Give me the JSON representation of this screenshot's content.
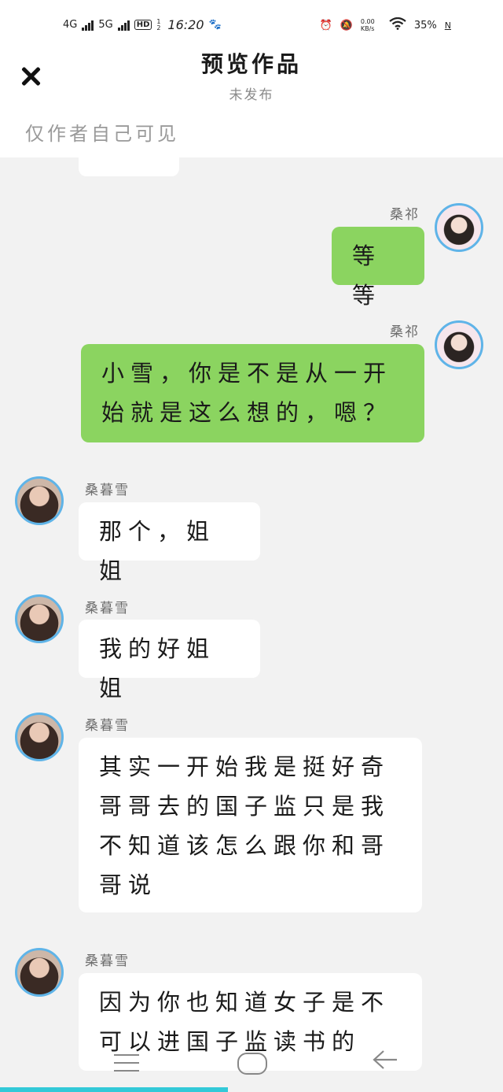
{
  "status_bar": {
    "net1": "4G",
    "net2": "5G",
    "hd": "HD",
    "hd_sub": "1 2",
    "time": "16:20",
    "speed": "0.00 KB/s",
    "battery": "35%",
    "nfc": "N"
  },
  "header": {
    "title": "预览作品",
    "subtitle": "未发布",
    "visibility_note": "仅作者自己可见"
  },
  "messages": [
    {
      "sender": "桑祁",
      "side": "right",
      "text": "等等"
    },
    {
      "sender": "桑祁",
      "side": "right",
      "text": "小雪，你是不是从一开始就是这么想的，嗯？"
    },
    {
      "sender": "桑暮雪",
      "side": "left",
      "text": "那个，姐姐"
    },
    {
      "sender": "桑暮雪",
      "side": "left",
      "text": "我的好姐姐"
    },
    {
      "sender": "桑暮雪",
      "side": "left",
      "text": "其实一开始我是挺好奇哥哥去的国子监只是我不知道该怎么跟你和哥哥说"
    },
    {
      "sender": "桑暮雪",
      "side": "left",
      "text": "因为你也知道女子是不可以进国子监读书的"
    }
  ],
  "colors": {
    "outgoing_bubble": "#8bd460",
    "incoming_bubble": "#ffffff",
    "avatar_ring": "#5fb4e8",
    "progress": "#33c9d8"
  },
  "icons": [
    "close-icon",
    "menu-icon",
    "home-icon",
    "back-icon",
    "alarm-icon",
    "mute-bell-icon",
    "wifi-icon"
  ]
}
